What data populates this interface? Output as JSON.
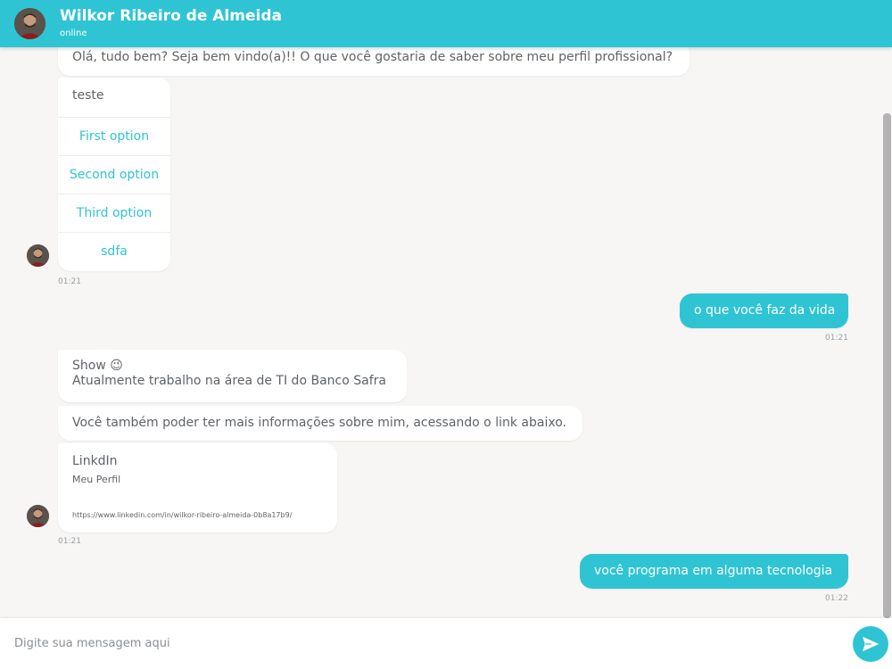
{
  "header": {
    "name": "Wilkor Ribeiro de Almeida",
    "status": "online"
  },
  "messages": {
    "welcome": "Olá, tudo bem? Seja bem vindo(a)!! O que você gostaria de saber sobre meu perfil profissional?",
    "options": {
      "title": "teste",
      "items": [
        "First option",
        "Second option",
        "Third option",
        "sdfa"
      ]
    },
    "time1": "01:21",
    "user1": "o que você faz da vida",
    "time_user1": "01:21",
    "show_line1": "Show",
    "show_emoji": "😉",
    "show_line2": "Atualmente trabalho na área de TI do Banco Safra",
    "info": "Você também poder ter mais informações sobre mim, acessando o link abaixo.",
    "link": {
      "title": "LinkdIn",
      "subtitle": "Meu Perfil",
      "url": "https://www.linkedin.com/in/wilkor-ribeiro-almeida-0b8a17b9/"
    },
    "time2": "01:21",
    "user2": "você programa em alguma tecnologia",
    "time_user2": "01:22"
  },
  "composer": {
    "placeholder": "Digite sua mensagem aqui"
  },
  "colors": {
    "accent": "#2fc4d3",
    "background": "#f7f6f5"
  },
  "icons": {
    "send": "send-icon",
    "avatar": "avatar-photo"
  }
}
